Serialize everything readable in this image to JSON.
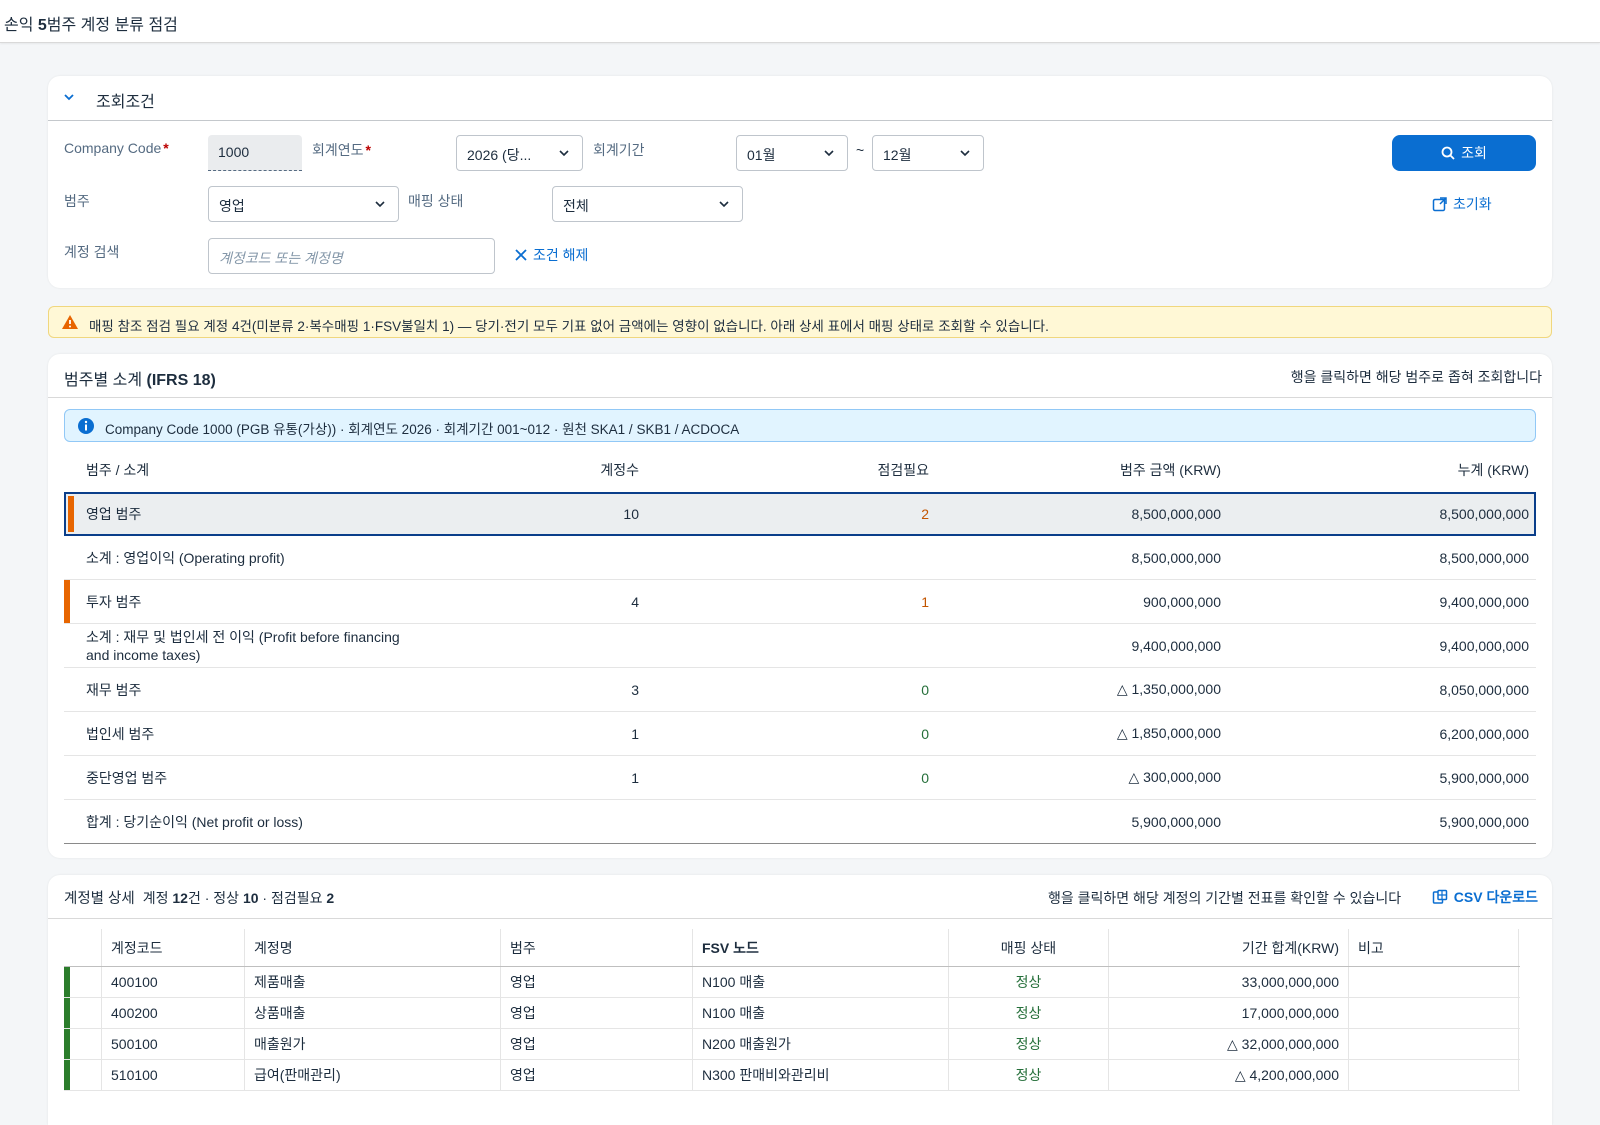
{
  "app": {
    "title_prefix": "손익 ",
    "title_bold": "5",
    "title_suffix": "범주 계정 분류 점검"
  },
  "filter": {
    "section_title": "조회조건",
    "company_code_label": "Company Code",
    "company_code_value": "1000",
    "fiscal_year_label": "회계연도",
    "fiscal_year_value": "2026 (당...",
    "period_label": "회계기간",
    "period_from": "01월",
    "period_sep": "~",
    "period_to": "12월",
    "category_label": "범주",
    "category_value": "영업",
    "mapping_label": "매핑 상태",
    "mapping_value": "전체",
    "search_label": "계정 검색",
    "search_placeholder": "계정코드 또는 계정명",
    "clear_label": "조건 해제",
    "search_button": "조회",
    "reset_button": "초기화"
  },
  "warning": {
    "text": "매핑 참조 점검 필요 계정 4건(미분류 2·복수매핑 1·FSV불일치 1) — 당기·전기 모두 기표 없어 금액에는 영향이 없습니다. 아래 상세 표에서 매핑 상태로 조회할 수 있습니다."
  },
  "summary": {
    "title": "범주별 소계 ",
    "title_bold": "(IFRS 18)",
    "hint": "행을 클릭하면 해당 범주로 좁혀 조회합니다",
    "info": "Company Code 1000 (PGB 유통(가상)) · 회계연도 2026 · 회계기간 001~012 · 원천 SKA1 / SKB1 / ACDOCA",
    "headers": [
      "범주 / 소계",
      "계정수",
      "점검필요",
      "범주 금액 (KRW)",
      "누계 (KRW)"
    ],
    "rows": [
      {
        "name": "영업 범주",
        "count": "10",
        "check": "2",
        "amount": "8,500,000,000",
        "cumulative": "8,500,000,000"
      },
      {
        "name": "소계 : 영업이익 (Operating profit)",
        "count": "",
        "check": "",
        "amount": "8,500,000,000",
        "cumulative": "8,500,000,000"
      },
      {
        "name": "투자 범주",
        "count": "4",
        "check": "1",
        "amount": "900,000,000",
        "cumulative": "9,400,000,000"
      },
      {
        "name": "소계 : 재무 및 법인세 전 이익 (Profit before financing and income taxes)",
        "count": "",
        "check": "",
        "amount": "9,400,000,000",
        "cumulative": "9,400,000,000"
      },
      {
        "name": "재무 범주",
        "count": "3",
        "check": "0",
        "amount": "△ 1,350,000,000",
        "cumulative": "8,050,000,000"
      },
      {
        "name": "법인세 범주",
        "count": "1",
        "check": "0",
        "amount": "△ 1,850,000,000",
        "cumulative": "6,200,000,000"
      },
      {
        "name": "중단영업 범주",
        "count": "1",
        "check": "0",
        "amount": "△ 300,000,000",
        "cumulative": "5,900,000,000"
      },
      {
        "name": "합계 : 당기순이익 (Net profit or loss)",
        "count": "",
        "check": "",
        "amount": "5,900,000,000",
        "cumulative": "5,900,000,000"
      }
    ]
  },
  "detail": {
    "title": "계정별 상세",
    "sub_prefix": "계정 ",
    "total": "12",
    "sub_mid": "건 · 정상 ",
    "normal": "10",
    "sub_mid2": " · 점검필요 ",
    "check": "2",
    "hint": "행을 클릭하면 해당 계정의 기간별 전표를 확인할 수 있습니다",
    "csv_label": "CSV 다운로드",
    "headers": [
      "계정코드",
      "계정명",
      "범주",
      "FSV 노드",
      "매핑 상태",
      "기간 합계(KRW)",
      "비고"
    ],
    "rows": [
      {
        "code": "400100",
        "name": "제품매출",
        "category": "영업",
        "fsv": "N100 매출",
        "status": "정상",
        "amount": "33,000,000,000",
        "note": ""
      },
      {
        "code": "400200",
        "name": "상품매출",
        "category": "영업",
        "fsv": "N100 매출",
        "status": "정상",
        "amount": "17,000,000,000",
        "note": ""
      },
      {
        "code": "500100",
        "name": "매출원가",
        "category": "영업",
        "fsv": "N200 매출원가",
        "status": "정상",
        "amount": "△ 32,000,000,000",
        "note": ""
      },
      {
        "code": "510100",
        "name": "급여(판매관리)",
        "category": "영업",
        "fsv": "N300 판매비와관리비",
        "status": "정상",
        "amount": "△ 4,200,000,000",
        "note": ""
      }
    ]
  },
  "colors": {
    "accent": "#0a6ed1",
    "operating_bar": "#e76500",
    "normal_bar": "#2b7d2b",
    "warning_bg": "#fff8d6",
    "info_bg": "#e1f4ff"
  }
}
